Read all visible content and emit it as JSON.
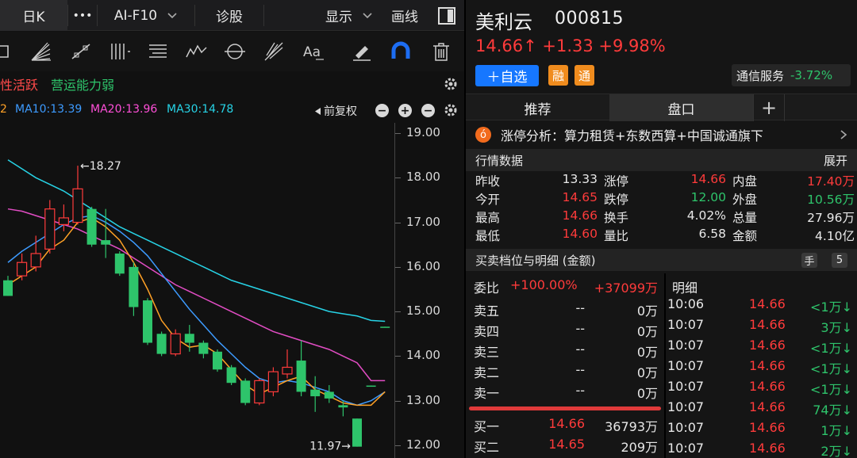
{
  "toolbar": {
    "period": "日K",
    "more": "•••",
    "f10": "AI-F10",
    "diagnose": "诊股",
    "display": "显示",
    "draw": "画线"
  },
  "tags": {
    "tag1": "性活跃",
    "tag2": "营运能力弱"
  },
  "ma": {
    "ma5_partial": "2",
    "ma10": "MA10:13.39",
    "ma20": "MA20:13.96",
    "ma30": "MA30:14.78",
    "adjust": "前复权"
  },
  "chart_data": {
    "type": "candlestick",
    "y_axis_labels": [
      "19.00",
      "18.00",
      "17.00",
      "16.00",
      "15.00",
      "14.00",
      "13.00",
      "12.00"
    ],
    "ylim": [
      12.0,
      19.0
    ],
    "annotations": {
      "high": "←18.27",
      "low": "11.97→"
    },
    "candles": [
      {
        "o": 15.7,
        "c": 15.35,
        "h": 15.8,
        "l": 15.35
      },
      {
        "o": 15.8,
        "c": 16.1,
        "h": 16.3,
        "l": 15.7
      },
      {
        "o": 16.0,
        "c": 16.3,
        "h": 16.7,
        "l": 15.9
      },
      {
        "o": 16.4,
        "c": 17.3,
        "h": 17.5,
        "l": 16.3
      },
      {
        "o": 16.95,
        "c": 17.1,
        "h": 17.4,
        "l": 16.8
      },
      {
        "o": 17.0,
        "c": 17.75,
        "h": 18.27,
        "l": 16.95
      },
      {
        "o": 17.3,
        "c": 16.5,
        "h": 17.35,
        "l": 16.45
      },
      {
        "o": 16.6,
        "c": 16.5,
        "h": 17.3,
        "l": 16.2
      },
      {
        "o": 16.3,
        "c": 15.85,
        "h": 16.35,
        "l": 15.8
      },
      {
        "o": 16.0,
        "c": 15.1,
        "h": 16.1,
        "l": 14.9
      },
      {
        "o": 15.25,
        "c": 14.3,
        "h": 15.3,
        "l": 14.25
      },
      {
        "o": 14.5,
        "c": 14.05,
        "h": 14.55,
        "l": 14.0
      },
      {
        "o": 14.05,
        "c": 14.5,
        "h": 14.6,
        "l": 14.0
      },
      {
        "o": 14.5,
        "c": 14.3,
        "h": 14.7,
        "l": 14.1
      },
      {
        "o": 14.3,
        "c": 14.05,
        "h": 14.35,
        "l": 13.95
      },
      {
        "o": 14.1,
        "c": 13.7,
        "h": 14.15,
        "l": 13.65
      },
      {
        "o": 13.75,
        "c": 13.4,
        "h": 13.8,
        "l": 13.35
      },
      {
        "o": 13.45,
        "c": 12.95,
        "h": 13.5,
        "l": 12.9
      },
      {
        "o": 12.95,
        "c": 13.45,
        "h": 13.5,
        "l": 12.9
      },
      {
        "o": 13.2,
        "c": 13.65,
        "h": 13.75,
        "l": 13.1
      },
      {
        "o": 13.6,
        "c": 13.75,
        "h": 14.15,
        "l": 13.5
      },
      {
        "o": 13.9,
        "c": 13.2,
        "h": 14.35,
        "l": 13.1
      },
      {
        "o": 13.25,
        "c": 13.1,
        "h": 13.55,
        "l": 12.75
      },
      {
        "o": 13.2,
        "c": 13.05,
        "h": 13.35,
        "l": 12.95
      },
      {
        "o": 12.9,
        "c": 12.85,
        "h": 13.0,
        "l": 12.65
      },
      {
        "o": 12.6,
        "c": 11.97,
        "h": 12.6,
        "l": 11.97
      },
      {
        "o": 13.34,
        "c": 13.33,
        "h": 13.34,
        "l": 13.32
      },
      {
        "o": 14.66,
        "c": 14.65,
        "h": 14.66,
        "l": 14.64
      }
    ],
    "ma10": [
      16.1,
      16.35,
      16.55,
      16.75,
      16.95,
      17.1,
      17.15,
      17.0,
      16.8,
      16.55,
      16.25,
      15.85,
      15.45,
      15.05,
      14.7,
      14.35,
      14.05,
      13.75,
      13.5,
      13.4,
      13.45,
      13.4,
      13.3,
      13.2,
      13.0,
      12.9,
      13.0,
      13.2
    ],
    "ma20": [
      17.3,
      17.25,
      17.15,
      17.05,
      16.95,
      16.85,
      16.7,
      16.55,
      16.4,
      16.2,
      16.0,
      15.8,
      15.6,
      15.45,
      15.3,
      15.15,
      15.0,
      14.85,
      14.7,
      14.55,
      14.45,
      14.35,
      14.25,
      14.15,
      14.0,
      13.85,
      13.45,
      13.45
    ],
    "ma30": [
      18.4,
      18.2,
      18.0,
      17.85,
      17.7,
      17.5,
      17.3,
      17.1,
      16.9,
      16.75,
      16.6,
      16.45,
      16.3,
      16.15,
      16.0,
      15.85,
      15.7,
      15.6,
      15.5,
      15.4,
      15.3,
      15.2,
      15.1,
      15.0,
      14.95,
      14.9,
      14.8,
      14.78
    ],
    "ma5": [
      15.6,
      15.8,
      16.0,
      16.4,
      16.6,
      17.0,
      17.1,
      16.9,
      16.6,
      16.1,
      15.5,
      14.8,
      14.4,
      14.2,
      14.25,
      14.05,
      13.7,
      13.35,
      13.15,
      13.3,
      13.45,
      13.55,
      13.25,
      13.1,
      12.95,
      12.9,
      12.9,
      13.2
    ]
  },
  "stock": {
    "name": "美利云",
    "code": "000815",
    "price_line": "14.66↑ +1.33 +9.98%",
    "add_watch": "＋自选",
    "badge1": "融",
    "badge2": "通",
    "sector": "通信服务",
    "sector_change": "-3.72%"
  },
  "tabs": {
    "recommend": "推荐",
    "market": "盘口",
    "add": "+"
  },
  "analysis": {
    "icon": "ó",
    "text": "涨停分析：算力租赁+东数西算+中国诚通旗下"
  },
  "quote": {
    "header": "行情数据",
    "expand": "展开",
    "rows": [
      [
        "昨收",
        "13.33",
        "涨停",
        "14.66",
        "内盘",
        "17.40万"
      ],
      [
        "今开",
        "14.65",
        "跌停",
        "12.00",
        "外盘",
        "10.56万"
      ],
      [
        "最高",
        "14.66",
        "换手",
        "4.02%",
        "总量",
        "27.96万"
      ],
      [
        "最低",
        "14.60",
        "量比",
        "6.58",
        "金额",
        "4.10亿"
      ]
    ]
  },
  "book": {
    "header": "买卖档位与明细 (金额)",
    "hand": "手",
    "five": "5",
    "ratio_label": "委比",
    "ratio": "+100.00%",
    "diff": "+37099万",
    "asks": [
      [
        "卖五",
        "--",
        "0万"
      ],
      [
        "卖四",
        "--",
        "0万"
      ],
      [
        "卖三",
        "--",
        "0万"
      ],
      [
        "卖二",
        "--",
        "0万"
      ],
      [
        "卖一",
        "--",
        "0万"
      ]
    ],
    "bids": [
      [
        "买一",
        "14.66",
        "36793万"
      ],
      [
        "买二",
        "14.65",
        "209万"
      ]
    ]
  },
  "detail": {
    "header": "明细",
    "rows": [
      [
        "10:06",
        "14.66",
        "<1万↓"
      ],
      [
        "10:07",
        "14.66",
        "3万↓"
      ],
      [
        "10:07",
        "14.66",
        "<1万↓"
      ],
      [
        "10:07",
        "14.66",
        "<1万↓"
      ],
      [
        "10:07",
        "14.66",
        "<1万↓"
      ],
      [
        "10:07",
        "14.66",
        "74万↓"
      ],
      [
        "10:07",
        "14.66",
        "1万↓"
      ],
      [
        "10:07",
        "14.66",
        "2万↓"
      ]
    ]
  }
}
